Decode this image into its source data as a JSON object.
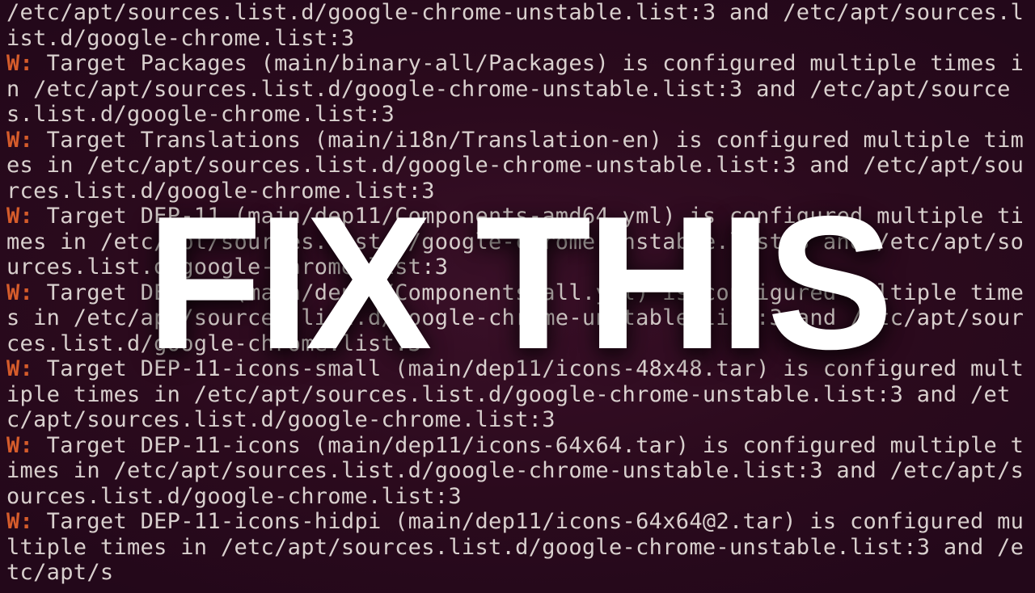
{
  "overlay": {
    "text": "FIX THIS"
  },
  "terminal": {
    "warn_prefix": "W:",
    "lines": [
      {
        "prefix": "",
        "text": "/etc/apt/sources.list.d/google-chrome-unstable.list:3 and /etc/apt/sources.list.d/google-chrome.list:3"
      },
      {
        "prefix": "W:",
        "text": " Target Packages (main/binary-all/Packages) is configured multiple times in /etc/apt/sources.list.d/google-chrome-unstable.list:3 and /etc/apt/sources.list.d/google-chrome.list:3"
      },
      {
        "prefix": "W:",
        "text": " Target Translations (main/i18n/Translation-en) is configured multiple times in /etc/apt/sources.list.d/google-chrome-unstable.list:3 and /etc/apt/sources.list.d/google-chrome.list:3"
      },
      {
        "prefix": "W:",
        "text": " Target DEP-11 (main/dep11/Components-amd64.yml) is configured multiple times in /etc/apt/sources.list.d/google-chrome-unstable.list:3 and /etc/apt/sources.list.d/google-chrome.list:3"
      },
      {
        "prefix": "W:",
        "text": " Target DEP-11 (main/dep11/Components-all.yml) is configured multiple times in /etc/apt/sources.list.d/google-chrome-unstable.list:3 and /etc/apt/sources.list.d/google-chrome.list:3"
      },
      {
        "prefix": "W:",
        "text": " Target DEP-11-icons-small (main/dep11/icons-48x48.tar) is configured multiple times in /etc/apt/sources.list.d/google-chrome-unstable.list:3 and /etc/apt/sources.list.d/google-chrome.list:3"
      },
      {
        "prefix": "W:",
        "text": " Target DEP-11-icons (main/dep11/icons-64x64.tar) is configured multiple times in /etc/apt/sources.list.d/google-chrome-unstable.list:3 and /etc/apt/sources.list.d/google-chrome.list:3"
      },
      {
        "prefix": "W:",
        "text": " Target DEP-11-icons-hidpi (main/dep11/icons-64x64@2.tar) is configured multiple times in /etc/apt/sources.list.d/google-chrome-unstable.list:3 and /etc/apt/s"
      }
    ]
  }
}
